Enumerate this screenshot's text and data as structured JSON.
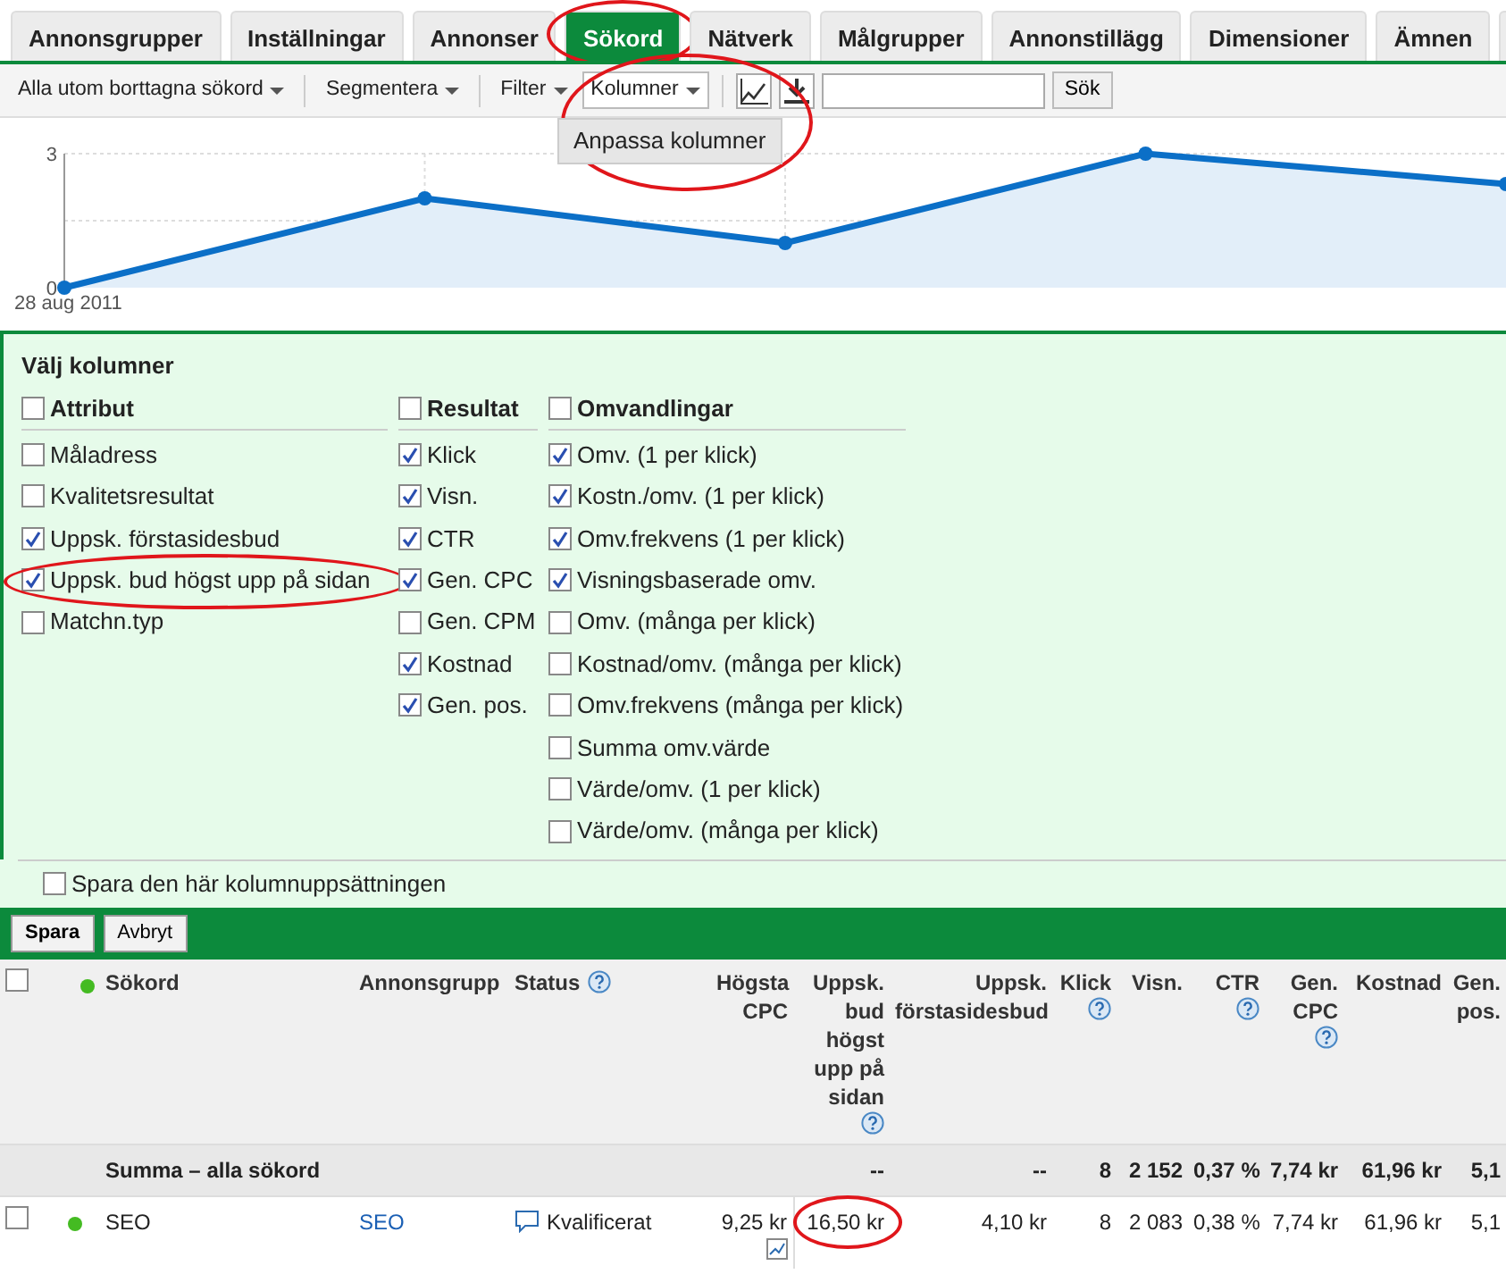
{
  "tabs": [
    {
      "label": "Annonsgrupper",
      "selected": false,
      "circled": false
    },
    {
      "label": "Inställningar",
      "selected": false,
      "circled": false
    },
    {
      "label": "Annonser",
      "selected": false,
      "circled": false
    },
    {
      "label": "Sökord",
      "selected": true,
      "circled": true
    },
    {
      "label": "Nätverk",
      "selected": false,
      "circled": false
    },
    {
      "label": "Målgrupper",
      "selected": false,
      "circled": false
    },
    {
      "label": "Annonstillägg",
      "selected": false,
      "circled": false
    },
    {
      "label": "Dimensioner",
      "selected": false,
      "circled": false
    },
    {
      "label": "Ämnen",
      "selected": false,
      "circled": false
    }
  ],
  "toolbar": {
    "menus": [
      {
        "label": "Alla utom borttagna sökord",
        "kind": "menu"
      },
      {
        "label": "Segmentera",
        "kind": "menu"
      },
      {
        "label": "Filter",
        "kind": "menu"
      },
      {
        "label": "Kolumner",
        "kind": "button",
        "circled": true
      }
    ],
    "search_button": "Sök",
    "dropdown": {
      "item": "Anpassa kolumner"
    }
  },
  "chart": {
    "chart_data": {
      "type": "area",
      "values": [
        0,
        2,
        1,
        3,
        2.32
      ],
      "ylim": [
        0,
        3
      ],
      "yticks": [
        {
          "value": 0,
          "label": "0"
        },
        {
          "value": 3,
          "label": "3"
        }
      ],
      "annotations": [
        {
          "text": "28 aug 2011"
        }
      ]
    }
  },
  "column_chooser": {
    "title": "Välj kolumner",
    "groups": [
      {
        "label": "Attribut",
        "checked": false,
        "items": [
          {
            "label": "Måladress",
            "checked": false,
            "circled": false
          },
          {
            "label": "Kvalitetsresultat",
            "checked": false,
            "circled": false
          },
          {
            "label": "Uppsk. förstasidesbud",
            "checked": true,
            "circled": false
          },
          {
            "label": "Uppsk. bud högst upp på sidan",
            "checked": true,
            "circled": true
          },
          {
            "label": "Matchn.typ",
            "checked": false,
            "circled": false
          }
        ]
      },
      {
        "label": "Resultat",
        "checked": false,
        "items": [
          {
            "label": "Klick",
            "checked": true
          },
          {
            "label": "Visn.",
            "checked": true
          },
          {
            "label": "CTR",
            "checked": true
          },
          {
            "label": "Gen. CPC",
            "checked": true
          },
          {
            "label": "Gen. CPM",
            "checked": false
          },
          {
            "label": "Kostnad",
            "checked": true
          },
          {
            "label": "Gen. pos.",
            "checked": true
          }
        ]
      },
      {
        "label": "Omvandlingar",
        "checked": false,
        "items": [
          {
            "label": "Omv. (1 per klick)",
            "checked": true
          },
          {
            "label": "Kostn./omv. (1 per klick)",
            "checked": true
          },
          {
            "label": "Omv.frekvens (1 per klick)",
            "checked": true
          },
          {
            "label": "Visningsbaserade omv.",
            "checked": true
          },
          {
            "label": "Omv. (många per klick)",
            "checked": false
          },
          {
            "label": "Kostnad/omv. (många per klick)",
            "checked": false
          },
          {
            "label": "Omv.frekvens (många per klick)",
            "checked": false
          },
          {
            "label": "Summa omv.värde",
            "checked": false
          },
          {
            "label": "Värde/omv. (1 per klick)",
            "checked": false
          },
          {
            "label": "Värde/omv. (många per klick)",
            "checked": false
          }
        ]
      }
    ],
    "save_set": {
      "label": "Spara den här kolumnuppsättningen",
      "checked": false
    },
    "buttons": [
      "Spara",
      "Avbryt"
    ]
  },
  "table": {
    "columns": [
      {
        "kind": "check",
        "checked": false
      },
      {
        "kind": "dot",
        "color": "#44bb22"
      },
      {
        "label": "Sökord",
        "help": false,
        "kind": "text"
      },
      {
        "label": "Annonsgrupp",
        "help": false,
        "kind": "text"
      },
      {
        "label": "Status",
        "help": true,
        "kind": "text"
      },
      {
        "label": "Högsta CPC",
        "help": false,
        "kind": "number"
      },
      {
        "label": "Uppsk. bud högst upp på sidan",
        "help": true,
        "kind": "number"
      },
      {
        "label": "Uppsk. förstasidesbud",
        "help": false,
        "kind": "number"
      },
      {
        "label": "Klick",
        "help": true,
        "kind": "number"
      },
      {
        "label": "Visn.",
        "help": false,
        "kind": "number"
      },
      {
        "label": "CTR",
        "help": true,
        "kind": "number"
      },
      {
        "label": "Gen. CPC",
        "help": true,
        "kind": "number"
      },
      {
        "label": "Kostnad",
        "help": false,
        "kind": "number"
      },
      {
        "label": "Gen. pos.",
        "help": false,
        "kind": "number"
      }
    ],
    "rows": [
      {
        "kind": "summary",
        "cells": [
          {
            "text": ""
          },
          {
            "text": ""
          },
          {
            "text": "Summa – alla sökord",
            "colspan": 4
          },
          {
            "text": "--"
          },
          {
            "text": "--"
          },
          {
            "text": "8"
          },
          {
            "text": "2 152"
          },
          {
            "text": "0,37 %"
          },
          {
            "text": "7,74 kr"
          },
          {
            "text": "61,96 kr"
          },
          {
            "text": "5,1"
          }
        ]
      },
      {
        "kind": "data",
        "cells": [
          {
            "kind": "check",
            "checked": false
          },
          {
            "kind": "dot",
            "color": "#44bb22"
          },
          {
            "text": "SEO"
          },
          {
            "text": "SEO"
          },
          {
            "text": "Kvalificerat"
          },
          {
            "text": "9,25 kr"
          },
          {
            "text": "16,50 kr",
            "circled": true
          },
          {
            "text": "4,10 kr"
          },
          {
            "text": "8"
          },
          {
            "text": "2 083"
          },
          {
            "text": "0,38 %"
          },
          {
            "text": "7,74 kr"
          },
          {
            "text": "61,96 kr"
          },
          {
            "text": "5,1"
          }
        ]
      }
    ]
  }
}
